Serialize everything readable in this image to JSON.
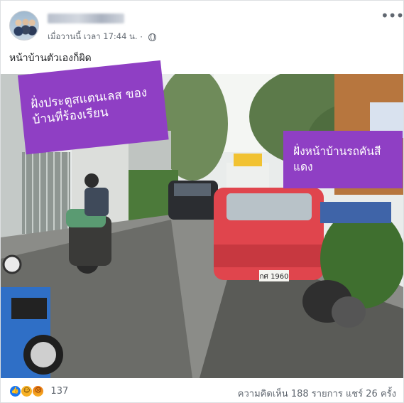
{
  "post": {
    "timestamp": "เมื่อวานนี้ เวลา 17:44 น.",
    "separator": "·",
    "text": "หน้าบ้านตัวเองก็ผิด"
  },
  "photo": {
    "left_label": "ฝั่งประตูสแตนเลส ของบ้านที่ร้องเรียน",
    "right_label": "ฝั่งหน้าบ้านรถคันสีแดง",
    "plate": "กศ 1960"
  },
  "footer": {
    "reactions_count": "137",
    "comments": "ความคิดเห็น 188 รายการ",
    "shares": "แชร์ 26 ครั้ง"
  },
  "icons": {
    "like": "like-icon",
    "haha": "haha-icon",
    "angry": "angry-icon",
    "privacy": "globe-icon",
    "menu": "more-options-icon"
  },
  "colors": {
    "label_bg": "#8f3fc4",
    "like_blue": "#1877f2",
    "car_red": "#e0454d"
  }
}
